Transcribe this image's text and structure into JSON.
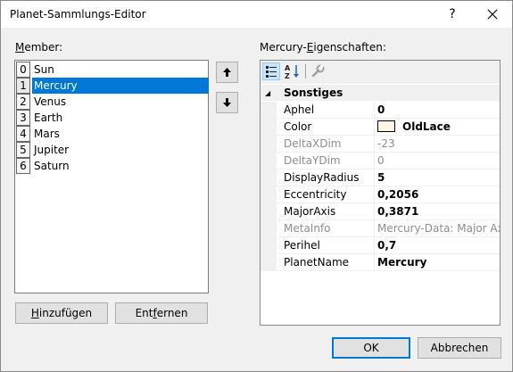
{
  "window": {
    "title": "Planet-Sammlungs-Editor",
    "help_label": "?"
  },
  "members": {
    "label_pre": "",
    "label_underline": "M",
    "label_post": "ember:",
    "items": [
      {
        "index": "0",
        "name": "Sun"
      },
      {
        "index": "1",
        "name": "Mercury",
        "selected": true
      },
      {
        "index": "2",
        "name": "Venus"
      },
      {
        "index": "3",
        "name": "Earth"
      },
      {
        "index": "4",
        "name": "Mars"
      },
      {
        "index": "5",
        "name": "Jupiter"
      },
      {
        "index": "6",
        "name": "Saturn"
      }
    ],
    "move_up_icon": "arrow-up-icon",
    "move_down_icon": "arrow-down-icon"
  },
  "buttons": {
    "add_pre": "",
    "add_underline": "H",
    "add_post": "inzufügen",
    "remove_pre": "Ent",
    "remove_underline": "f",
    "remove_post": "ernen",
    "ok": "OK",
    "cancel": "Abbrechen"
  },
  "properties": {
    "label_pre": "Mercury-",
    "label_underline": "E",
    "label_post": "igenschaften:",
    "toolbar": [
      "categorized-icon",
      "alphabetical-icon",
      "property-pages-icon"
    ],
    "category": "Sonstiges",
    "rows": [
      {
        "name": "Aphel",
        "value": "0",
        "bold": true,
        "readonly": false
      },
      {
        "name": "Color",
        "value": "OldLace",
        "bold": true,
        "readonly": false,
        "swatch": "#fdf5e6"
      },
      {
        "name": "DeltaXDim",
        "value": "-23",
        "bold": false,
        "readonly": true
      },
      {
        "name": "DeltaYDim",
        "value": "0",
        "bold": false,
        "readonly": true
      },
      {
        "name": "DisplayRadius",
        "value": "5",
        "bold": true,
        "readonly": false
      },
      {
        "name": "Eccentricity",
        "value": "0,2056",
        "bold": true,
        "readonly": false
      },
      {
        "name": "MajorAxis",
        "value": "0,3871",
        "bold": true,
        "readonly": false
      },
      {
        "name": "MetaInfo",
        "value": "Mercury-Data: Major Axis:",
        "bold": false,
        "readonly": true
      },
      {
        "name": "Perihel",
        "value": "0,7",
        "bold": true,
        "readonly": false
      },
      {
        "name": "PlanetName",
        "value": "Mercury",
        "bold": true,
        "readonly": false
      }
    ]
  },
  "colors": {
    "selection": "#0078d7",
    "default_button_border": "#0078d7"
  }
}
